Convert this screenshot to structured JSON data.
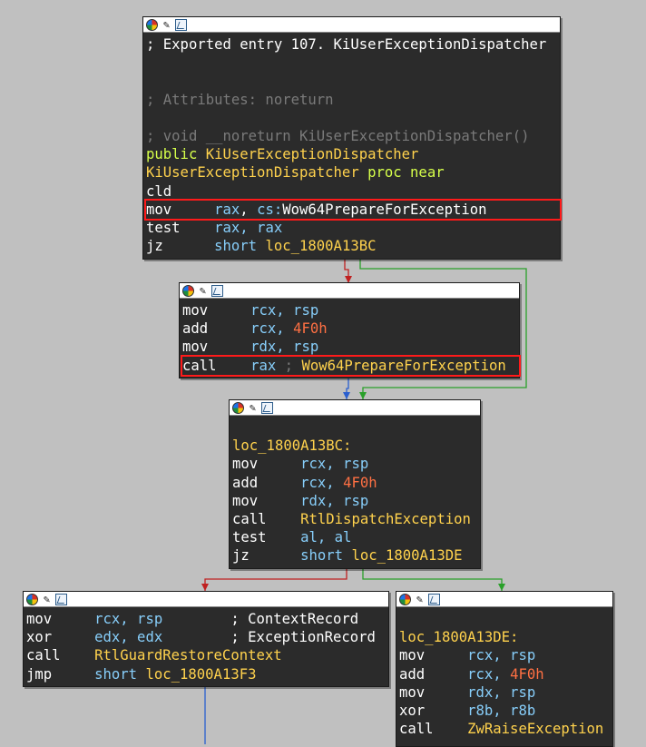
{
  "colors": {
    "background": "#c0c0c0",
    "node_bg": "#2b2b2b",
    "edge_true": "#2aa02a",
    "edge_false": "#c02020",
    "edge_uncond": "#2a5fcf",
    "highlight": "#ff1a1a"
  },
  "node_toolbar_icons": [
    "color-palette-icon",
    "rename-icon",
    "graph-view-icon"
  ],
  "nodes": {
    "entry": {
      "lines": [
        "; Exported entry 107. KiUserExceptionDispatcher",
        "",
        "",
        "; Attributes: noreturn",
        "",
        "; void __noreturn KiUserExceptionDispatcher()",
        "public KiUserExceptionDispatcher",
        "KiUserExceptionDispatcher proc near",
        "cld",
        "mov     rax, cs:Wow64PrepareForException",
        "test    rax, rax",
        "jz      short loc_1800A13BC"
      ],
      "parts": {
        "l0": "; Exported entry 107. KiUserExceptionDispatcher",
        "l3": "; Attributes: noreturn",
        "l5": "; void __noreturn KiUserExceptionDispatcher()",
        "l6a": "public ",
        "l6b": "KiUserExceptionDispatcher",
        "l7a": "KiUserExceptionDispatcher",
        "l7b": " proc near",
        "l8": "cld",
        "l9a": "mov     ",
        "l9b": "rax",
        "l9c": ", ",
        "l9d": "cs:",
        "l9e": "Wow64PrepareForException",
        "l10a": "test    ",
        "l10b": "rax, rax",
        "l11a": "jz      ",
        "l11b": "short ",
        "l11c": "loc_1800A13BC"
      }
    },
    "prep": {
      "p0a": "mov     ",
      "p0b": "rcx, rsp",
      "p1a": "add     ",
      "p1b": "rcx, ",
      "p1c": "4F0h",
      "p2a": "mov     ",
      "p2b": "rdx, rsp",
      "p3a": "call    ",
      "p3b": "rax",
      "p3c": " ; ",
      "p3d": "Wow64PrepareForException"
    },
    "dispatch": {
      "label": "loc_1800A13BC:",
      "d0a": "mov     ",
      "d0b": "rcx, rsp",
      "d1a": "add     ",
      "d1b": "rcx, ",
      "d1c": "4F0h",
      "d2a": "mov     ",
      "d2b": "rdx, rsp",
      "d3a": "call    ",
      "d3b": "RtlDispatchException",
      "d4a": "test    ",
      "d4b": "al, al",
      "d5a": "jz      ",
      "d5b": "short ",
      "d5c": "loc_1800A13DE"
    },
    "restore": {
      "r0a": "mov     ",
      "r0b": "rcx, rsp",
      "r0c": "        ; ",
      "r0d": "ContextRecord",
      "r1a": "xor     ",
      "r1b": "edx, edx",
      "r1c": "        ; ",
      "r1d": "ExceptionRecord",
      "r2a": "call    ",
      "r2b": "RtlGuardRestoreContext",
      "r3a": "jmp     ",
      "r3b": "short ",
      "r3c": "loc_1800A13F3"
    },
    "raise": {
      "label": "loc_1800A13DE:",
      "z0a": "mov     ",
      "z0b": "rcx, rsp",
      "z1a": "add     ",
      "z1b": "rcx, ",
      "z1c": "4F0h",
      "z2a": "mov     ",
      "z2b": "rdx, rsp",
      "z3a": "xor     ",
      "z3b": "r8b, r8b",
      "z4a": "call    ",
      "z4b": "ZwRaiseException"
    }
  }
}
